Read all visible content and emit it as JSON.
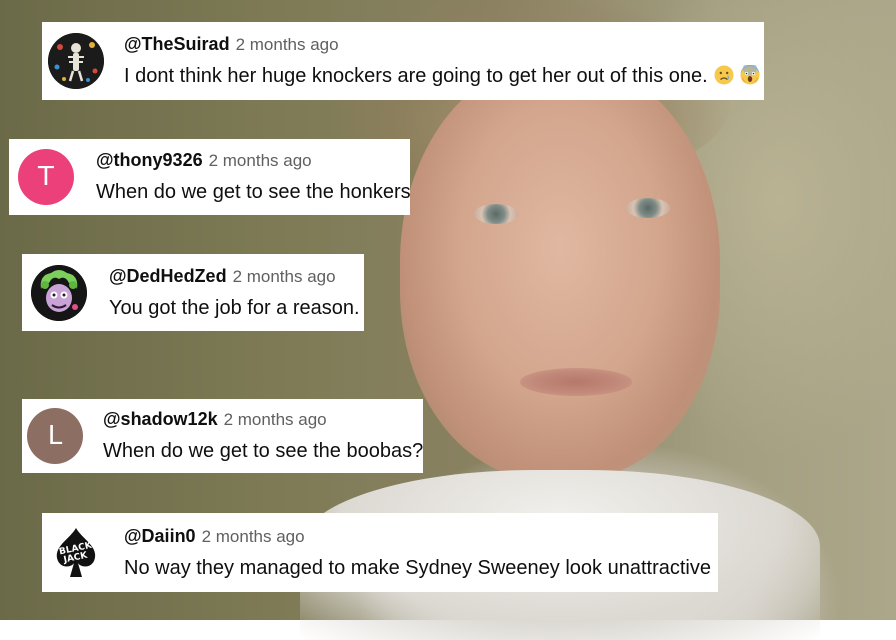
{
  "comments": [
    {
      "handle": "@TheSuirad",
      "time": "2 months ago",
      "text": "I dont think her huge knockers are going to get her out of this one.",
      "avatar": {
        "type": "image",
        "icon": "skeleton-art-avatar-icon",
        "bg": "#1b1b1b"
      },
      "emojis": [
        "crying-face-icon",
        "screaming-face-icon"
      ]
    },
    {
      "handle": "@thony9326",
      "time": "2 months ago",
      "text": "When do we get to see the honkers",
      "avatar": {
        "type": "letter",
        "letter": "T",
        "bg": "#ec407a"
      },
      "emojis": []
    },
    {
      "handle": "@DedHedZed",
      "time": "2 months ago",
      "text": "You got the job for a reason.",
      "avatar": {
        "type": "image",
        "icon": "green-zombie-avatar-icon",
        "bg": "#151515"
      },
      "emojis": []
    },
    {
      "handle": "@shadow12k",
      "time": "2 months ago",
      "text": "When do we get to see the boobas?",
      "avatar": {
        "type": "letter",
        "letter": "L",
        "bg": "#8d6e63"
      },
      "emojis": []
    },
    {
      "handle": "@Daiin0",
      "time": "2 months ago",
      "text": "No way they managed to make Sydney Sweeney look unattractive",
      "avatar": {
        "type": "image",
        "icon": "black-jack-spade-avatar-icon",
        "bg": "#ffffff",
        "logo_text": "BLACK JACK"
      },
      "emojis": []
    }
  ]
}
